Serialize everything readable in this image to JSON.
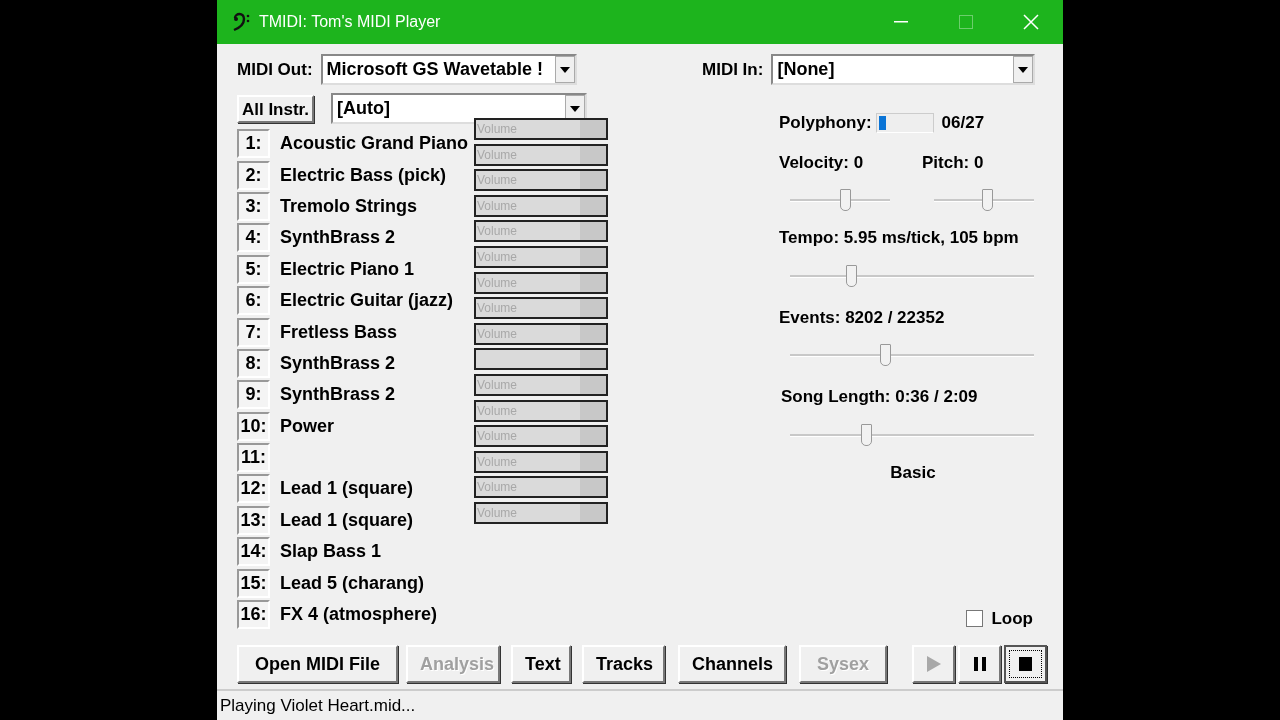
{
  "window": {
    "title": "TMIDI: Tom's MIDI Player",
    "maximize_disabled": true
  },
  "midi_out": {
    "label": "MIDI Out:",
    "value": "Microsoft GS Wavetable !"
  },
  "all_instruments": {
    "button": "All Instr.",
    "value": "[Auto]"
  },
  "channels": [
    {
      "number": "1:",
      "instrument": "Acoustic Grand Piano"
    },
    {
      "number": "2:",
      "instrument": "Electric Bass (pick)"
    },
    {
      "number": "3:",
      "instrument": "Tremolo Strings"
    },
    {
      "number": "4:",
      "instrument": "SynthBrass 2"
    },
    {
      "number": "5:",
      "instrument": "Electric Piano 1"
    },
    {
      "number": "6:",
      "instrument": "Electric Guitar (jazz)"
    },
    {
      "number": "7:",
      "instrument": "Fretless Bass"
    },
    {
      "number": "8:",
      "instrument": "SynthBrass 2"
    },
    {
      "number": "9:",
      "instrument": "SynthBrass 2"
    },
    {
      "number": "10:",
      "instrument": "Power"
    },
    {
      "number": "11:"
    },
    {
      "number": "12:",
      "instrument": "Lead 1 (square)"
    },
    {
      "number": "13:",
      "instrument": "Lead 1 (square)"
    },
    {
      "number": "14:",
      "instrument": "Slap Bass 1"
    },
    {
      "number": "15:",
      "instrument": "Lead 5 (charang)"
    },
    {
      "number": "16:",
      "instrument": "FX 4 (atmosphere)"
    }
  ],
  "volume_meters": [
    {
      "kind": "labeled",
      "label": "Volume"
    },
    {
      "kind": "labeled",
      "label": "Volume"
    },
    {
      "kind": "labeled",
      "label": "Volume"
    },
    {
      "kind": "labeled",
      "label": "Volume"
    },
    {
      "kind": "labeled",
      "label": "Volume"
    },
    {
      "kind": "labeled",
      "label": "Volume"
    },
    {
      "kind": "labeled",
      "label": "Volume"
    },
    {
      "kind": "labeled",
      "label": "Volume"
    },
    {
      "kind": "labeled",
      "label": "Volume"
    },
    {
      "kind": "blank"
    },
    {
      "kind": "labeled",
      "label": "Volume"
    },
    {
      "kind": "labeled",
      "label": "Volume"
    },
    {
      "kind": "labeled",
      "label": "Volume"
    },
    {
      "kind": "labeled",
      "label": "Volume"
    },
    {
      "kind": "labeled",
      "label": "Volume"
    },
    {
      "kind": "labeled",
      "label": "Volume"
    }
  ],
  "midi_in": {
    "label": "MIDI In:",
    "value": "[None]"
  },
  "polyphony": {
    "label": "Polyphony:",
    "level": 0.15,
    "reading": "06/27"
  },
  "velocity": {
    "label": "Velocity: 0",
    "level": 0.55
  },
  "pitch": {
    "label": "Pitch: 0",
    "level": 0.53
  },
  "tempo": {
    "label": "Tempo: 5.95 ms/tick, 105 bpm",
    "level": 0.25
  },
  "events": {
    "label": "Events:  8202 / 22352",
    "level": 0.39
  },
  "song_length": {
    "label": "Song Length: 0:36 / 2:09",
    "level": 0.31
  },
  "mode": "Basic",
  "loop": {
    "label": "Loop",
    "checked": false
  },
  "buttons": [
    {
      "label": "Open MIDI File",
      "disabled": false
    },
    {
      "label": "Analysis",
      "disabled": true
    },
    {
      "label": "Text",
      "disabled": false
    },
    {
      "label": "Tracks",
      "disabled": false
    },
    {
      "label": "Channels",
      "disabled": false
    },
    {
      "label": "Sysex",
      "disabled": true
    }
  ],
  "transport": [
    {
      "kind": "play",
      "disabled": true,
      "focused": false
    },
    {
      "kind": "pause",
      "disabled": false,
      "focused": false
    },
    {
      "kind": "stop",
      "disabled": false,
      "focused": true
    }
  ],
  "status_bar": "Playing Violet Heart.mid..."
}
